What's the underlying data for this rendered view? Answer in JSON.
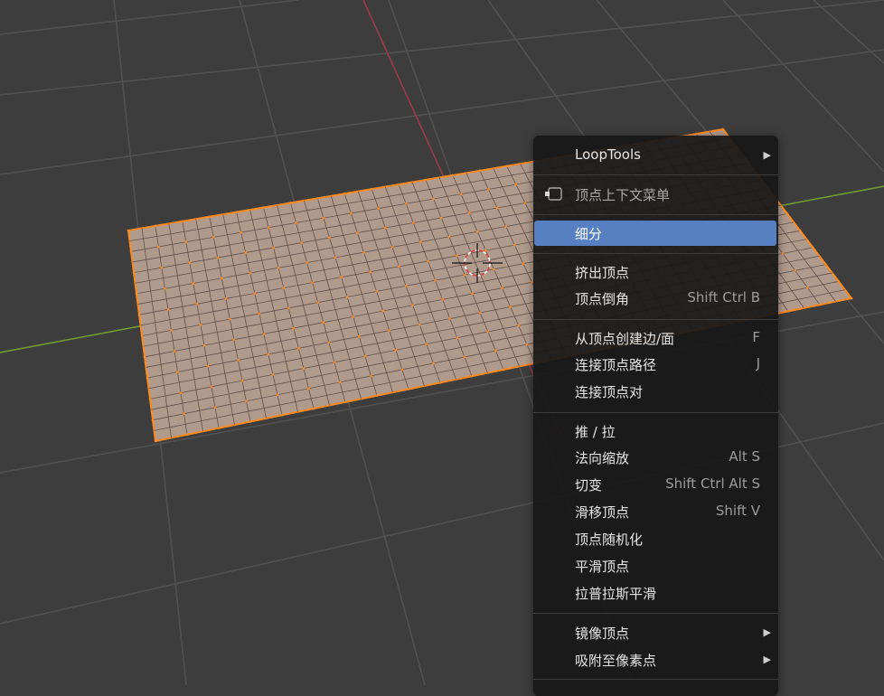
{
  "menu": {
    "items": [
      {
        "label": "LoopTools",
        "shortcut": "",
        "submenu": true
      },
      {
        "label": "顶点上下文菜单",
        "icon": "vertex-context-icon"
      },
      {
        "label": "细分",
        "highlighted": true
      },
      {
        "label": "挤出顶点",
        "shortcut": ""
      },
      {
        "label": "顶点倒角",
        "shortcut": "Shift Ctrl B"
      },
      {
        "label": "从顶点创建边/面",
        "shortcut": "F"
      },
      {
        "label": "连接顶点路径",
        "shortcut": "J"
      },
      {
        "label": "连接顶点对",
        "shortcut": ""
      },
      {
        "label": "推 / 拉",
        "shortcut": ""
      },
      {
        "label": "法向缩放",
        "shortcut": "Alt S"
      },
      {
        "label": "切变",
        "shortcut": "Shift Ctrl Alt S"
      },
      {
        "label": "滑移顶点",
        "shortcut": "Shift V"
      },
      {
        "label": "顶点随机化",
        "shortcut": ""
      },
      {
        "label": "平滑顶点",
        "shortcut": ""
      },
      {
        "label": "拉普拉斯平滑",
        "shortcut": ""
      },
      {
        "label": "镜像顶点",
        "shortcut": "",
        "submenu": true
      },
      {
        "label": "吸附至像素点",
        "shortcut": "",
        "submenu": true
      }
    ]
  },
  "viewport": {
    "background_color": "#3d3d3d",
    "grid_color": "#515151",
    "x_axis_color": "#9b3b4f",
    "y_axis_color": "#6f9a32",
    "mesh_fill_color": "#b09a8c",
    "mesh_edge_color": "#ff8a1f",
    "mesh_grid_color": "#62524a"
  }
}
